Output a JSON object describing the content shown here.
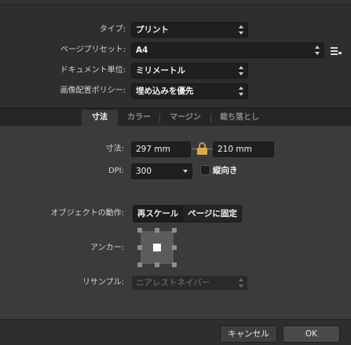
{
  "document_setup": {
    "type": {
      "label": "タイプ:",
      "value": "プリント"
    },
    "page_preset": {
      "label": "ページプリセット:",
      "value": "A4"
    },
    "document_units": {
      "label": "ドキュメント単位:",
      "value": "ミリメートル"
    },
    "image_placement_policy": {
      "label": "画像配置ポリシー:",
      "value": "埋め込みを優先"
    }
  },
  "tabs": [
    {
      "label": "寸法",
      "active": true
    },
    {
      "label": "カラー",
      "active": false
    },
    {
      "label": "マージン",
      "active": false
    },
    {
      "label": "裁ち落とし",
      "active": false
    }
  ],
  "dimensions": {
    "size_label": "寸法:",
    "width": "297 mm",
    "height": "210 mm",
    "dpi_label": "DPI:",
    "dpi": "300",
    "portrait_label": "縦向き",
    "portrait_checked": false,
    "object_action_label": "オブジェクトの動作:",
    "rescale_label": "再スケール",
    "anchor_to_page_label": "ページに固定",
    "anchor_label": "アンカー:",
    "resample_label": "リサンプル:",
    "resample_value": "ニアレストネイバー"
  },
  "buttons": {
    "cancel": "キャンセル",
    "ok": "OK"
  },
  "icons": [
    "chevron-updown-icon",
    "list-menu-icon",
    "lock-icon",
    "chevron-down-icon",
    "anchor-grid-icon"
  ]
}
